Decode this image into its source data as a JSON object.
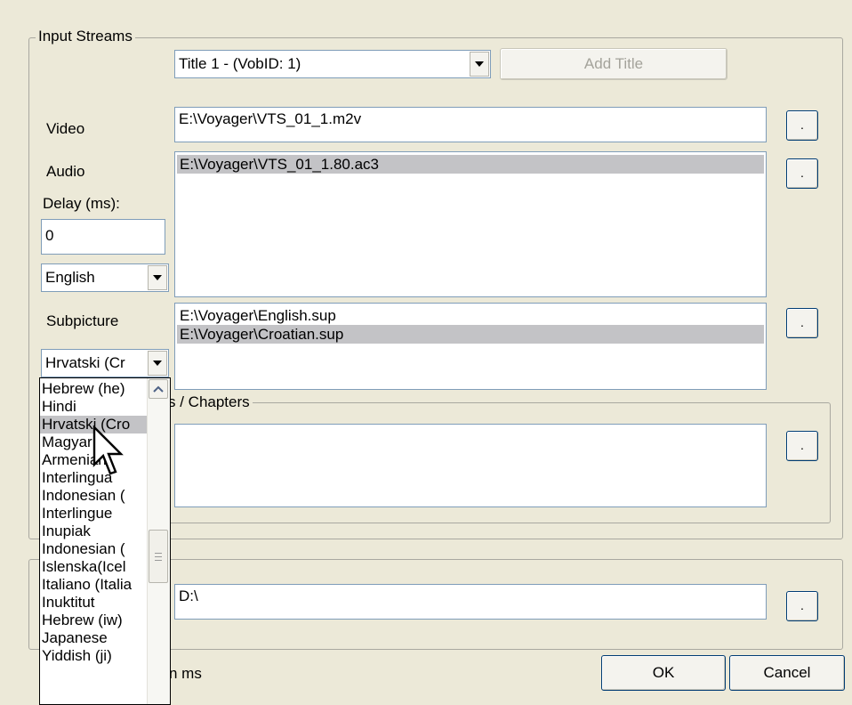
{
  "input_streams": {
    "legend": "Input Streams",
    "title_select": "Title 1 - (VobID: 1)",
    "add_title_label": "Add Title",
    "video_label": "Video",
    "video_path": "E:\\Voyager\\VTS_01_1.m2v",
    "audio_label": "Audio",
    "audio_files": [
      "E:\\Voyager\\VTS_01_1.80.ac3"
    ],
    "delay_label": "Delay (ms):",
    "delay_value": "0",
    "audio_language": "English",
    "subpicture_label": "Subpicture",
    "subpicture_files": [
      "E:\\Voyager\\English.sup",
      "E:\\Voyager\\Croatian.sup"
    ],
    "subpicture_language": "Hrvatski (Cr",
    "browse_label": "."
  },
  "chapters": {
    "legend": "s / Chapters"
  },
  "output": {
    "path": "D:\\"
  },
  "footer": {
    "units_text": "n ms",
    "ok_label": "OK",
    "cancel_label": "Cancel"
  },
  "language_dropdown": {
    "items": [
      "Hebrew (he)",
      "Hindi",
      "Hrvatski (Cro",
      "Magyar",
      "Armenian",
      "Interlingua",
      "Indonesian (",
      "Interlingue",
      "Inupiak",
      "Indonesian (",
      "Islenska(Icel",
      "Italiano (Italia",
      "Inuktitut",
      "Hebrew (iw)",
      "Japanese",
      "Yiddish (ji)"
    ],
    "selected_index": 2
  }
}
